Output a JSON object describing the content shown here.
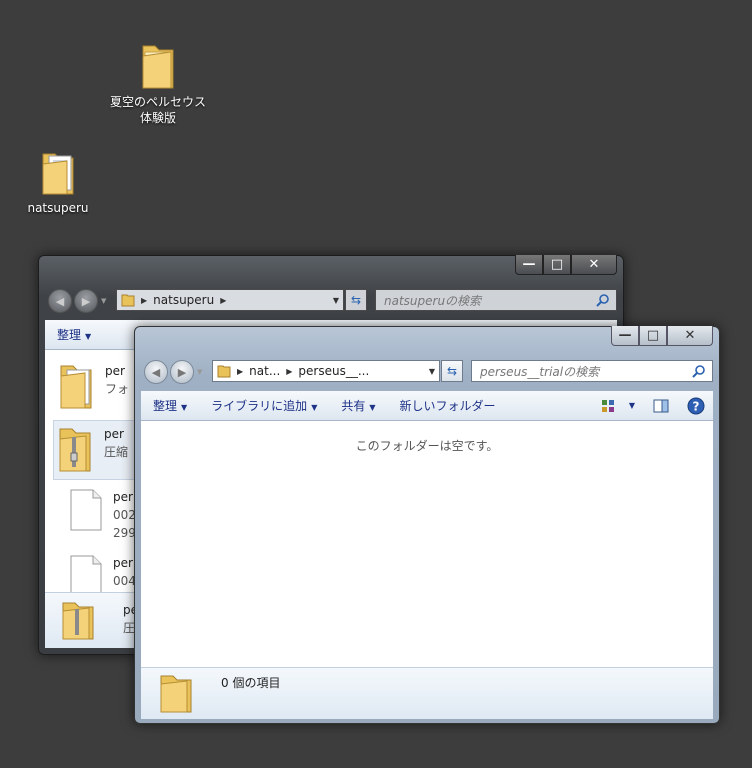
{
  "desktop": {
    "icons": [
      {
        "label_line1": "夏空のペルセウス",
        "label_line2": "体験版"
      },
      {
        "label_line1": "natsuperu",
        "label_line2": ""
      }
    ]
  },
  "back_window": {
    "address": {
      "crumb": "natsuperu"
    },
    "search_placeholder": "natsuperuの検索",
    "toolbar": {
      "organize": "整理"
    },
    "files": [
      {
        "name": "per",
        "sub": "フォ",
        "sub2": ""
      },
      {
        "name": "per",
        "sub": "圧縮",
        "sub2": ""
      },
      {
        "name": "per",
        "sub": "002",
        "sub2": "299"
      },
      {
        "name": "per",
        "sub": "004",
        "sub2": ""
      }
    ],
    "details": {
      "name": "pe",
      "sub": "圧"
    }
  },
  "front_window": {
    "address": {
      "crumb1": "nat...",
      "crumb2": "perseus__..."
    },
    "search_placeholder": "perseus__trialの検索",
    "toolbar": {
      "organize": "整理",
      "add_to_library": "ライブラリに追加",
      "share": "共有",
      "new_folder": "新しいフォルダー"
    },
    "empty_message": "このフォルダーは空です。",
    "status": {
      "item_count": "0 個の項目"
    }
  },
  "caption": {
    "minimize": "—",
    "maximize": "□",
    "close": "✕"
  }
}
